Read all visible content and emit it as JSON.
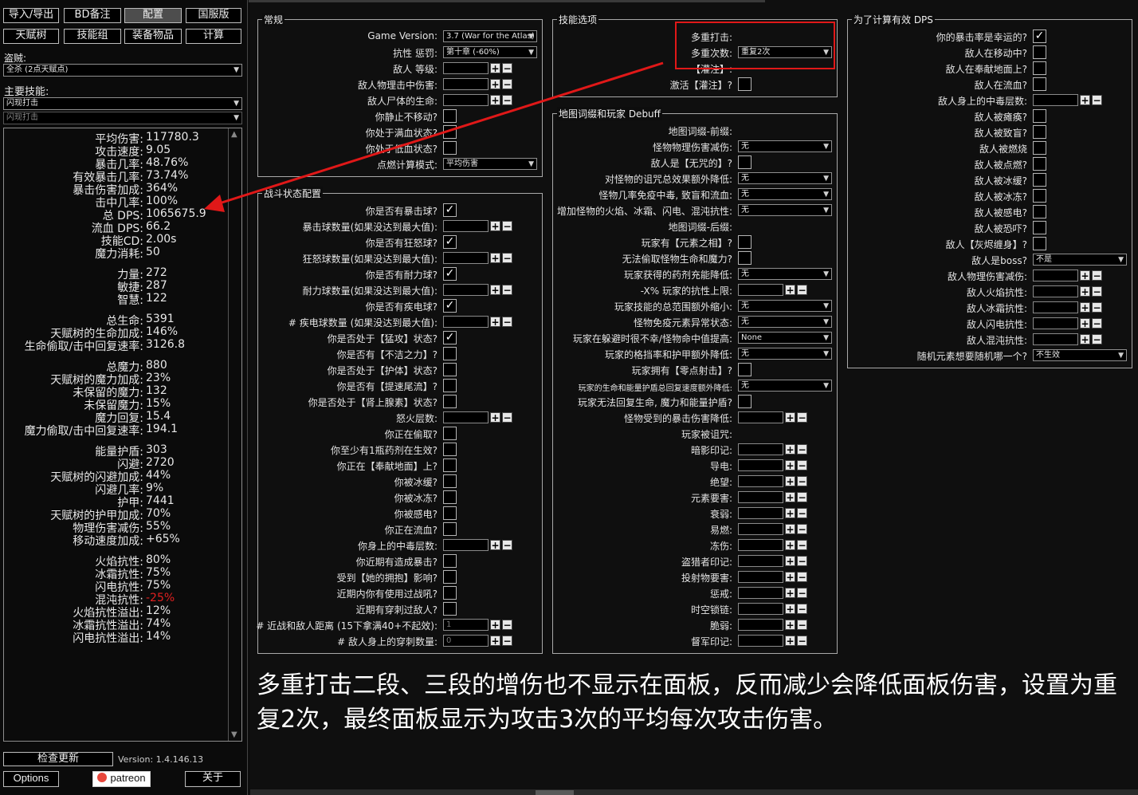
{
  "top_buttons": [
    {
      "label": "导入/导出",
      "active": false
    },
    {
      "label": "BD备注",
      "active": false
    },
    {
      "label": "配置",
      "active": true
    },
    {
      "label": "国服版",
      "active": false
    },
    {
      "label": "天赋树",
      "active": false
    },
    {
      "label": "技能组",
      "active": false
    },
    {
      "label": "装备物品",
      "active": false
    },
    {
      "label": "计算",
      "active": false
    }
  ],
  "bandit": {
    "label": "盗贼:",
    "value": "全杀 (2点天赋点)"
  },
  "main_skill": {
    "label": "主要技能:",
    "value": "闪现打击",
    "sub_value": "闪现打击"
  },
  "stats": [
    {
      "k": "平均伤害:",
      "v": "117780.3"
    },
    {
      "k": "攻击速度:",
      "v": "9.05"
    },
    {
      "k": "暴击几率:",
      "v": "48.76%"
    },
    {
      "k": "有效暴击几率:",
      "v": "73.74%"
    },
    {
      "k": "暴击伤害加成:",
      "v": "364%"
    },
    {
      "k": "击中几率:",
      "v": "100%"
    },
    {
      "k": "总 DPS:",
      "v": "1065675.9"
    },
    {
      "k": "流血 DPS:",
      "v": "66.2"
    },
    {
      "k": "技能CD:",
      "v": "2.00s"
    },
    {
      "k": "魔力消耗:",
      "v": "50"
    },
    {
      "gap": true
    },
    {
      "k": "力量:",
      "v": "272"
    },
    {
      "k": "敏捷:",
      "v": "287"
    },
    {
      "k": "智慧:",
      "v": "122"
    },
    {
      "gap": true
    },
    {
      "k": "总生命:",
      "v": "5391"
    },
    {
      "k": "天赋树的生命加成:",
      "v": "146%"
    },
    {
      "k": "生命偷取/击中回复速率:",
      "v": "3126.8"
    },
    {
      "gap": true
    },
    {
      "k": "总魔力:",
      "v": "880"
    },
    {
      "k": "天赋树的魔力加成:",
      "v": "23%"
    },
    {
      "k": "未保留的魔力:",
      "v": "132"
    },
    {
      "k": "未保留魔力:",
      "v": "15%"
    },
    {
      "k": "魔力回复:",
      "v": "15.4"
    },
    {
      "k": "魔力偷取/击中回复速率:",
      "v": "194.1"
    },
    {
      "gap": true
    },
    {
      "k": "能量护盾:",
      "v": "303"
    },
    {
      "k": "闪避:",
      "v": "2720"
    },
    {
      "k": "天赋树的闪避加成:",
      "v": "44%"
    },
    {
      "k": "闪避几率:",
      "v": "9%"
    },
    {
      "k": "护甲:",
      "v": "7441"
    },
    {
      "k": "天赋树的护甲加成:",
      "v": "70%"
    },
    {
      "k": "物理伤害减伤:",
      "v": "55%"
    },
    {
      "k": "移动速度加成:",
      "v": "+65%"
    },
    {
      "gap": true
    },
    {
      "k": "火焰抗性:",
      "v": "80%"
    },
    {
      "k": "冰霜抗性:",
      "v": "75%"
    },
    {
      "k": "闪电抗性:",
      "v": "75%"
    },
    {
      "k": "混沌抗性:",
      "v": "-25%",
      "color": "#e02020"
    },
    {
      "k": "火焰抗性溢出:",
      "v": "12%"
    },
    {
      "k": "冰霜抗性溢出:",
      "v": "74%"
    },
    {
      "k": "闪电抗性溢出:",
      "v": "14%"
    }
  ],
  "footer": {
    "check_update": "检查更新",
    "version": "Version: 1.4.146.13",
    "options": "Options",
    "patreon": "patreon",
    "about": "关于"
  },
  "panels": {
    "general": {
      "title": "常规",
      "rows": [
        {
          "label": "Game Version:",
          "type": "drop",
          "value": "3.7 (War for the Atlas)"
        },
        {
          "label": "抗性 惩罚:",
          "type": "drop",
          "value": "第十章 (-60%)"
        },
        {
          "label": "敌人 等级:",
          "type": "num"
        },
        {
          "label": "敌人物理击中伤害:",
          "type": "num"
        },
        {
          "label": "敌人尸体的生命:",
          "type": "num"
        },
        {
          "label": "你静止不移动?",
          "type": "chk"
        },
        {
          "label": "你处于满血状态?",
          "type": "chk"
        },
        {
          "label": "你处于低血状态?",
          "type": "chk"
        },
        {
          "label": "点燃计算模式:",
          "type": "drop",
          "value": "平均伤害"
        }
      ]
    },
    "skill_opts": {
      "title": "技能选项",
      "rows": [
        {
          "label": "多重打击:",
          "type": "none"
        },
        {
          "label": "多重次数:",
          "type": "drop",
          "value": "重复2次"
        },
        {
          "label": "【灌注】:",
          "type": "none"
        },
        {
          "label": "激活【灌注】?",
          "type": "chk"
        }
      ]
    },
    "combat": {
      "title": "战斗状态配置",
      "rows": [
        {
          "label": "你是否有暴击球?",
          "type": "chk",
          "checked": true
        },
        {
          "label": "暴击球数量(如果没达到最大值):",
          "type": "num"
        },
        {
          "label": "你是否有狂怒球?",
          "type": "chk",
          "checked": true
        },
        {
          "label": "狂怒球数量(如果没达到最大值):",
          "type": "num"
        },
        {
          "label": "你是否有耐力球?",
          "type": "chk",
          "checked": true
        },
        {
          "label": "耐力球数量(如果没达到最大值):",
          "type": "num"
        },
        {
          "label": "你是否有疾电球?",
          "type": "chk",
          "checked": true
        },
        {
          "label": "# 疾电球数量 (如果没达到最大值):",
          "type": "num"
        },
        {
          "label": "你是否处于【猛攻】状态?",
          "type": "chk",
          "checked": true
        },
        {
          "label": "你是否有【不洁之力】?",
          "type": "chk"
        },
        {
          "label": "你是否处于【护体】状态?",
          "type": "chk"
        },
        {
          "label": "你是否有【提速尾流】?",
          "type": "chk"
        },
        {
          "label": "你是否处于【肾上腺素】状态?",
          "type": "chk"
        },
        {
          "label": "怒火层数:",
          "type": "num"
        },
        {
          "label": "你正在偷取?",
          "type": "chk"
        },
        {
          "label": "你至少有1瓶药剂在生效?",
          "type": "chk"
        },
        {
          "label": "你正在【奉献地面】上?",
          "type": "chk"
        },
        {
          "label": "你被冰缓?",
          "type": "chk"
        },
        {
          "label": "你被冰冻?",
          "type": "chk"
        },
        {
          "label": "你被感电?",
          "type": "chk"
        },
        {
          "label": "你正在流血?",
          "type": "chk"
        },
        {
          "label": "你身上的中毒层数:",
          "type": "num"
        },
        {
          "label": "你近期有造成暴击?",
          "type": "chk"
        },
        {
          "label": "受到【她的拥抱】影响?",
          "type": "chk"
        },
        {
          "label": "近期内你有使用过战吼?",
          "type": "chk"
        },
        {
          "label": "近期有穿刺过敌人?",
          "type": "chk"
        },
        {
          "label": "# 近战和敌人距离 (15下拿满40+不起效):",
          "type": "num",
          "value": "1"
        },
        {
          "label": "# 敌人身上的穿刺数量:",
          "type": "num",
          "value": "0"
        }
      ]
    },
    "map": {
      "title": "地图词缀和玩家 Debuff",
      "rows": [
        {
          "label": "地图词缀-前缀:",
          "type": "none"
        },
        {
          "label": "怪物物理伤害减伤:",
          "type": "drop",
          "value": "无"
        },
        {
          "label": "敌人是【无咒的】?",
          "type": "chk"
        },
        {
          "label": "对怪物的诅咒总效果额外降低:",
          "type": "drop",
          "value": "无"
        },
        {
          "label": "怪物几率免疫中毒, 致盲和流血:",
          "type": "drop",
          "value": "无"
        },
        {
          "label": "增加怪物的火焰、冰霜、闪电、混沌抗性:",
          "type": "drop",
          "value": "无"
        },
        {
          "label": "地图词缀-后缀:",
          "type": "none"
        },
        {
          "label": "玩家有【元素之相】?",
          "type": "chk"
        },
        {
          "label": "无法偷取怪物生命和魔力?",
          "type": "chk"
        },
        {
          "label": "玩家获得的药剂充能降低:",
          "type": "drop",
          "value": "无"
        },
        {
          "label": "-X% 玩家的抗性上限:",
          "type": "num"
        },
        {
          "label": "玩家技能的总范围额外缩小:",
          "type": "drop",
          "value": "无"
        },
        {
          "label": "怪物免疫元素异常状态:",
          "type": "drop",
          "value": "无"
        },
        {
          "label": "玩家在躲避时很不幸/怪物命中值提高:",
          "type": "drop",
          "value": "None"
        },
        {
          "label": "玩家的格挡率和护甲额外降低:",
          "type": "drop",
          "value": "无"
        },
        {
          "label": "玩家拥有【零点射击】?",
          "type": "chk"
        },
        {
          "label": "玩家的生命和能量护盾总回复速度额外降低:",
          "type": "drop",
          "value": "无",
          "small": true
        },
        {
          "label": "玩家无法回复生命, 魔力和能量护盾?",
          "type": "chk"
        },
        {
          "label": "怪物受到的暴击伤害降低:",
          "type": "num"
        },
        {
          "label": "玩家被诅咒:",
          "type": "none"
        },
        {
          "label": "暗影印记:",
          "type": "num"
        },
        {
          "label": "导电:",
          "type": "num"
        },
        {
          "label": "绝望:",
          "type": "num"
        },
        {
          "label": "元素要害:",
          "type": "num"
        },
        {
          "label": "衰弱:",
          "type": "num"
        },
        {
          "label": "易燃:",
          "type": "num"
        },
        {
          "label": "冻伤:",
          "type": "num"
        },
        {
          "label": "盗猎者印记:",
          "type": "num"
        },
        {
          "label": "投射物要害:",
          "type": "num"
        },
        {
          "label": "惩戒:",
          "type": "num"
        },
        {
          "label": "时空锁链:",
          "type": "num"
        },
        {
          "label": "脆弱:",
          "type": "num"
        },
        {
          "label": "督军印记:",
          "type": "num"
        }
      ]
    },
    "effective": {
      "title": "为了计算有效 DPS",
      "rows": [
        {
          "label": "你的暴击率是幸运的?",
          "type": "chk",
          "checked": true
        },
        {
          "label": "敌人在移动中?",
          "type": "chk"
        },
        {
          "label": "敌人在奉献地面上?",
          "type": "chk"
        },
        {
          "label": "敌人在流血?",
          "type": "chk"
        },
        {
          "label": "敌人身上的中毒层数:",
          "type": "num"
        },
        {
          "label": "敌人被瘫痪?",
          "type": "chk"
        },
        {
          "label": "敌人被致盲?",
          "type": "chk"
        },
        {
          "label": "敌人被燃烧",
          "type": "chk"
        },
        {
          "label": "敌人被点燃?",
          "type": "chk"
        },
        {
          "label": "敌人被冰缓?",
          "type": "chk"
        },
        {
          "label": "敌人被冰冻?",
          "type": "chk"
        },
        {
          "label": "敌人被感电?",
          "type": "chk"
        },
        {
          "label": "敌人被恐吓?",
          "type": "chk"
        },
        {
          "label": "敌人【灰烬缠身】?",
          "type": "chk"
        },
        {
          "label": "敌人是boss?",
          "type": "drop",
          "value": "不是"
        },
        {
          "label": "敌人物理伤害减伤:",
          "type": "num"
        },
        {
          "label": "敌人火焰抗性:",
          "type": "num"
        },
        {
          "label": "敌人冰霜抗性:",
          "type": "num"
        },
        {
          "label": "敌人闪电抗性:",
          "type": "num"
        },
        {
          "label": "敌人混沌抗性:",
          "type": "num"
        },
        {
          "label": "随机元素想要随机哪一个?",
          "type": "drop",
          "value": "不生效"
        }
      ]
    }
  },
  "annotation": "多重打击二段、三段的增伤也不显示在面板，反而减少会降低面板伤害，设置为重复2次，最终面板显示为攻击3次的平均每次攻击伤害。",
  "accent": "#e01818"
}
